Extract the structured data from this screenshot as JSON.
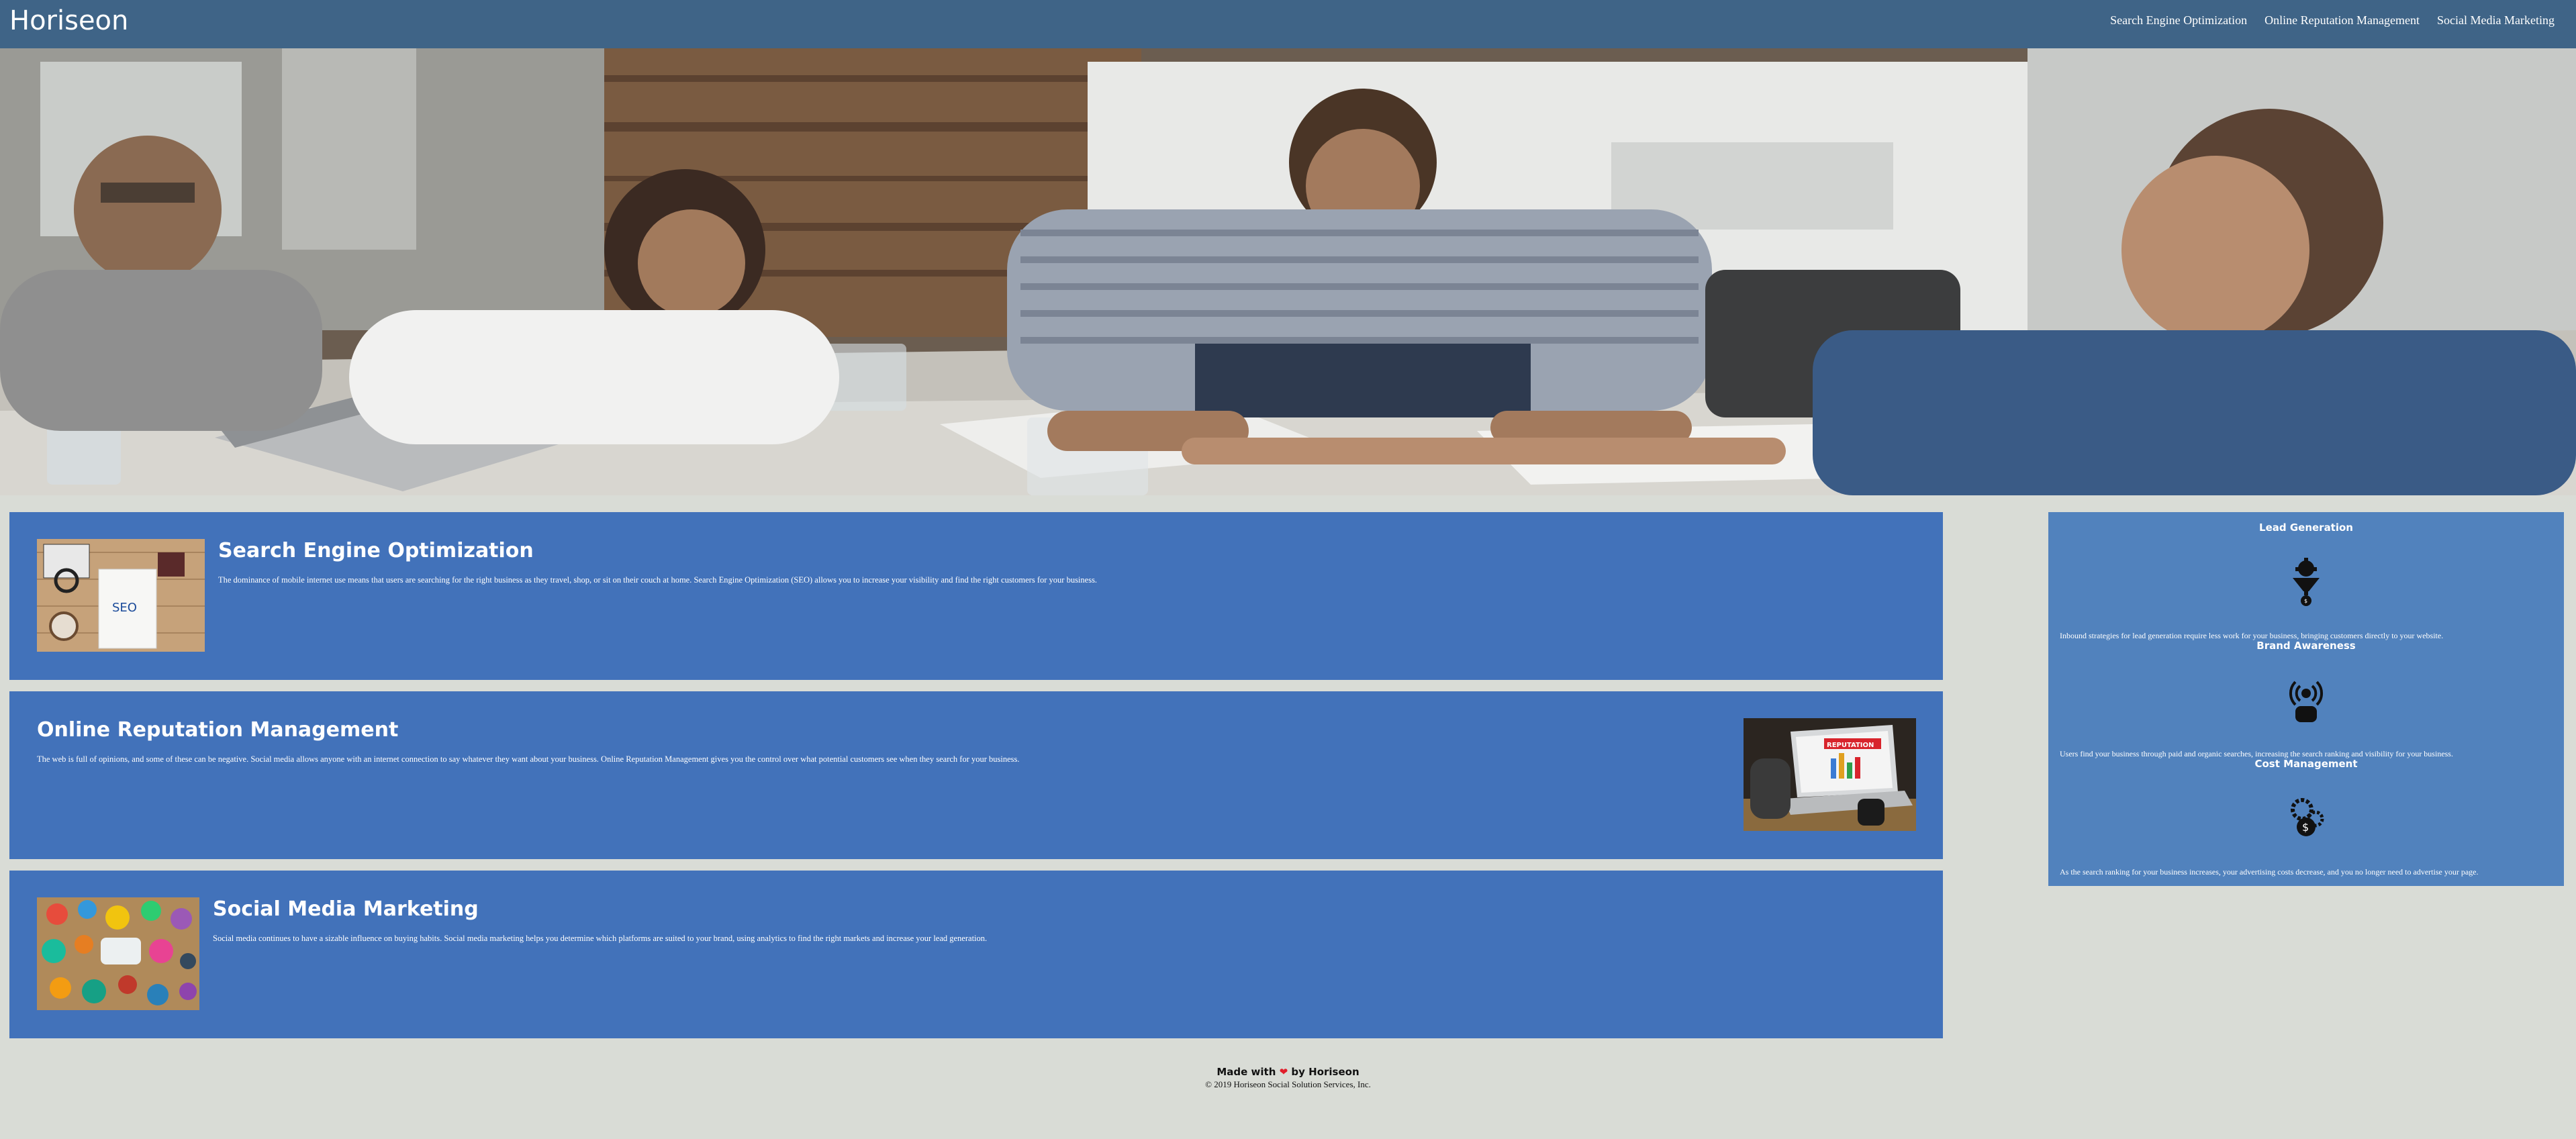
{
  "header": {
    "logo": "Horiseon",
    "nav": [
      "Search Engine Optimization",
      "Online Reputation Management",
      "Social Media Marketing"
    ]
  },
  "hero": {
    "alt": "Business team meeting photo"
  },
  "sections": [
    {
      "title": "Search Engine Optimization",
      "text": "The dominance of mobile internet use means that users are searching for the right business as they travel, shop, or sit on their couch at home. Search Engine Optimization (SEO) allows you to increase your visibility and find the right customers for your business.",
      "image_text": "SEO"
    },
    {
      "title": "Online Reputation Management",
      "text": "The web is full of opinions, and some of these can be negative. Social media allows anyone with an internet connection to say whatever they want about your business. Online Reputation Management gives you the control over what potential customers see when they search for your business.",
      "image_text": "REPUTATION"
    },
    {
      "title": "Social Media Marketing",
      "text": "Social media continues to have a sizable influence on buying habits. Social media marketing helps you determine which platforms are suited to your brand, using analytics to find the right markets and increase your lead generation."
    }
  ],
  "sidebar": [
    {
      "title": "Lead Generation",
      "text": "Inbound strategies for lead generation require less work for your business, bringing customers directly to your website.",
      "icon": "lead-funnel-icon"
    },
    {
      "title": "Brand Awareness",
      "text": "Users find your business through paid and organic searches, increasing the search ranking and visibility for your business.",
      "icon": "broadcast-person-icon"
    },
    {
      "title": "Cost Management",
      "text": "As the search ranking for your business increases, your advertising costs decrease, and you no longer need to advertise your page.",
      "icon": "gears-dollar-icon"
    }
  ],
  "footer": {
    "made_with": "Made with",
    "by": "by Horiseon",
    "copyright": "© 2019 Horiseon Social Solution Services, Inc."
  },
  "colors": {
    "header_bg": "#3f6487",
    "panel_bg": "#4272ba",
    "sidebar_bg": "#5182bd",
    "page_bg": "#d9dcd6",
    "heart": "#e11d2a"
  }
}
